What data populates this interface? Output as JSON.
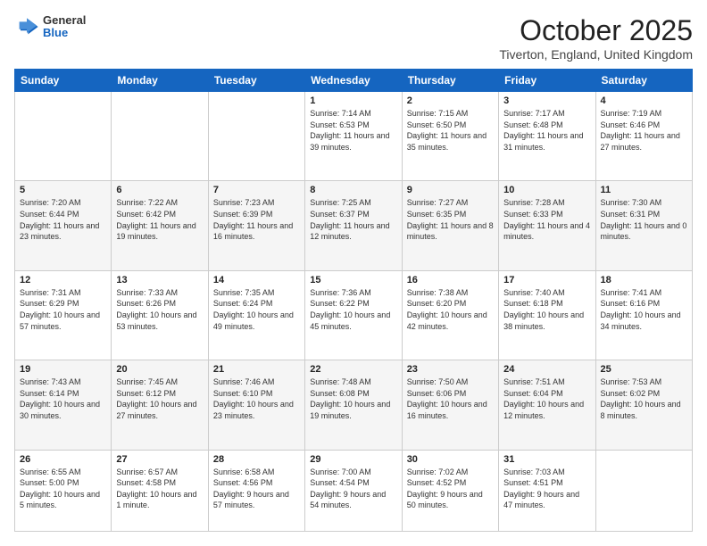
{
  "header": {
    "logo_general": "General",
    "logo_blue": "Blue",
    "month_title": "October 2025",
    "location": "Tiverton, England, United Kingdom"
  },
  "days_of_week": [
    "Sunday",
    "Monday",
    "Tuesday",
    "Wednesday",
    "Thursday",
    "Friday",
    "Saturday"
  ],
  "weeks": [
    [
      {
        "day": "",
        "content": ""
      },
      {
        "day": "",
        "content": ""
      },
      {
        "day": "",
        "content": ""
      },
      {
        "day": "1",
        "content": "Sunrise: 7:14 AM\nSunset: 6:53 PM\nDaylight: 11 hours\nand 39 minutes."
      },
      {
        "day": "2",
        "content": "Sunrise: 7:15 AM\nSunset: 6:50 PM\nDaylight: 11 hours\nand 35 minutes."
      },
      {
        "day": "3",
        "content": "Sunrise: 7:17 AM\nSunset: 6:48 PM\nDaylight: 11 hours\nand 31 minutes."
      },
      {
        "day": "4",
        "content": "Sunrise: 7:19 AM\nSunset: 6:46 PM\nDaylight: 11 hours\nand 27 minutes."
      }
    ],
    [
      {
        "day": "5",
        "content": "Sunrise: 7:20 AM\nSunset: 6:44 PM\nDaylight: 11 hours\nand 23 minutes."
      },
      {
        "day": "6",
        "content": "Sunrise: 7:22 AM\nSunset: 6:42 PM\nDaylight: 11 hours\nand 19 minutes."
      },
      {
        "day": "7",
        "content": "Sunrise: 7:23 AM\nSunset: 6:39 PM\nDaylight: 11 hours\nand 16 minutes."
      },
      {
        "day": "8",
        "content": "Sunrise: 7:25 AM\nSunset: 6:37 PM\nDaylight: 11 hours\nand 12 minutes."
      },
      {
        "day": "9",
        "content": "Sunrise: 7:27 AM\nSunset: 6:35 PM\nDaylight: 11 hours\nand 8 minutes."
      },
      {
        "day": "10",
        "content": "Sunrise: 7:28 AM\nSunset: 6:33 PM\nDaylight: 11 hours\nand 4 minutes."
      },
      {
        "day": "11",
        "content": "Sunrise: 7:30 AM\nSunset: 6:31 PM\nDaylight: 11 hours\nand 0 minutes."
      }
    ],
    [
      {
        "day": "12",
        "content": "Sunrise: 7:31 AM\nSunset: 6:29 PM\nDaylight: 10 hours\nand 57 minutes."
      },
      {
        "day": "13",
        "content": "Sunrise: 7:33 AM\nSunset: 6:26 PM\nDaylight: 10 hours\nand 53 minutes."
      },
      {
        "day": "14",
        "content": "Sunrise: 7:35 AM\nSunset: 6:24 PM\nDaylight: 10 hours\nand 49 minutes."
      },
      {
        "day": "15",
        "content": "Sunrise: 7:36 AM\nSunset: 6:22 PM\nDaylight: 10 hours\nand 45 minutes."
      },
      {
        "day": "16",
        "content": "Sunrise: 7:38 AM\nSunset: 6:20 PM\nDaylight: 10 hours\nand 42 minutes."
      },
      {
        "day": "17",
        "content": "Sunrise: 7:40 AM\nSunset: 6:18 PM\nDaylight: 10 hours\nand 38 minutes."
      },
      {
        "day": "18",
        "content": "Sunrise: 7:41 AM\nSunset: 6:16 PM\nDaylight: 10 hours\nand 34 minutes."
      }
    ],
    [
      {
        "day": "19",
        "content": "Sunrise: 7:43 AM\nSunset: 6:14 PM\nDaylight: 10 hours\nand 30 minutes."
      },
      {
        "day": "20",
        "content": "Sunrise: 7:45 AM\nSunset: 6:12 PM\nDaylight: 10 hours\nand 27 minutes."
      },
      {
        "day": "21",
        "content": "Sunrise: 7:46 AM\nSunset: 6:10 PM\nDaylight: 10 hours\nand 23 minutes."
      },
      {
        "day": "22",
        "content": "Sunrise: 7:48 AM\nSunset: 6:08 PM\nDaylight: 10 hours\nand 19 minutes."
      },
      {
        "day": "23",
        "content": "Sunrise: 7:50 AM\nSunset: 6:06 PM\nDaylight: 10 hours\nand 16 minutes."
      },
      {
        "day": "24",
        "content": "Sunrise: 7:51 AM\nSunset: 6:04 PM\nDaylight: 10 hours\nand 12 minutes."
      },
      {
        "day": "25",
        "content": "Sunrise: 7:53 AM\nSunset: 6:02 PM\nDaylight: 10 hours\nand 8 minutes."
      }
    ],
    [
      {
        "day": "26",
        "content": "Sunrise: 6:55 AM\nSunset: 5:00 PM\nDaylight: 10 hours\nand 5 minutes."
      },
      {
        "day": "27",
        "content": "Sunrise: 6:57 AM\nSunset: 4:58 PM\nDaylight: 10 hours\nand 1 minute."
      },
      {
        "day": "28",
        "content": "Sunrise: 6:58 AM\nSunset: 4:56 PM\nDaylight: 9 hours\nand 57 minutes."
      },
      {
        "day": "29",
        "content": "Sunrise: 7:00 AM\nSunset: 4:54 PM\nDaylight: 9 hours\nand 54 minutes."
      },
      {
        "day": "30",
        "content": "Sunrise: 7:02 AM\nSunset: 4:52 PM\nDaylight: 9 hours\nand 50 minutes."
      },
      {
        "day": "31",
        "content": "Sunrise: 7:03 AM\nSunset: 4:51 PM\nDaylight: 9 hours\nand 47 minutes."
      },
      {
        "day": "",
        "content": ""
      }
    ]
  ]
}
